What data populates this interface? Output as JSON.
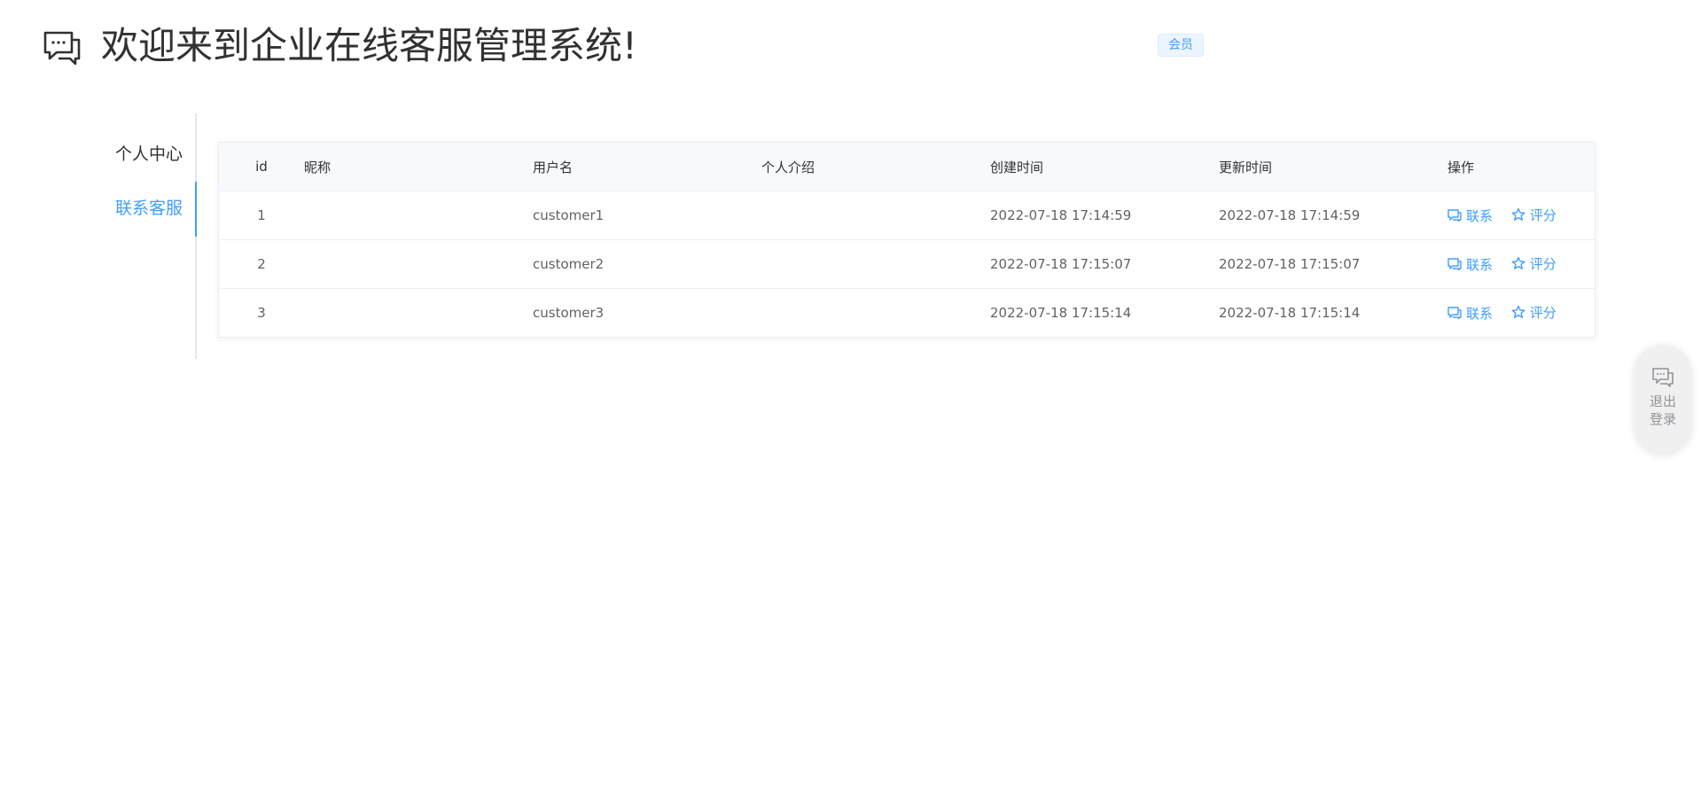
{
  "header": {
    "title": "欢迎来到企业在线客服管理系统!",
    "role_tag": "会员",
    "icon": "chat-bubble-icon"
  },
  "sidebar": {
    "items": [
      {
        "label": "个人中心",
        "active": false
      },
      {
        "label": "联系客服",
        "active": true
      }
    ],
    "accent_color": "#409eff"
  },
  "table": {
    "columns": [
      "id",
      "昵称",
      "用户名",
      "个人介绍",
      "创建时间",
      "更新时间",
      "操作"
    ],
    "rows": [
      {
        "id": "1",
        "nickname": "",
        "username": "customer1",
        "intro": "",
        "created": "2022-07-18 17:14:59",
        "updated": "2022-07-18 17:14:59"
      },
      {
        "id": "2",
        "nickname": "",
        "username": "customer2",
        "intro": "",
        "created": "2022-07-18 17:15:07",
        "updated": "2022-07-18 17:15:07"
      },
      {
        "id": "3",
        "nickname": "",
        "username": "customer3",
        "intro": "",
        "created": "2022-07-18 17:15:14",
        "updated": "2022-07-18 17:15:14"
      }
    ],
    "actions": {
      "contact_label": "联系",
      "contact_icon": "chat-icon",
      "rate_label": "评分",
      "rate_icon": "star-icon"
    }
  },
  "float_button": {
    "label": "退出登录",
    "icon": "chat-icon"
  }
}
